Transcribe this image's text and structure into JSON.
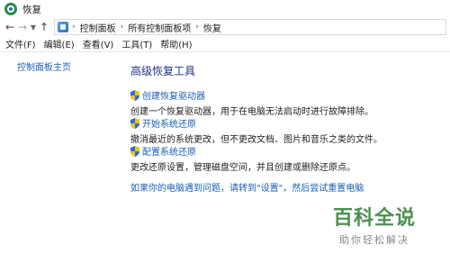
{
  "window": {
    "title": "恢复"
  },
  "address": {
    "crumbs": [
      "控制面板",
      "所有控制面板项",
      "恢复"
    ]
  },
  "menu": {
    "items": [
      "文件(F)",
      "编辑(E)",
      "查看(V)",
      "工具(T)",
      "帮助(H)"
    ]
  },
  "sidebar": {
    "home_link": "控制面板主页"
  },
  "main": {
    "heading": "高级恢复工具",
    "tasks": [
      {
        "link": "创建恢复驱动器",
        "description": "创建一个恢复驱动器，用于在电脑无法启动时进行故障排除。",
        "icon": "uac-shield-icon"
      },
      {
        "link": "开始系统还原",
        "description": "撤消最近的系统更改，但不更改文档、图片和音乐之类的文件。",
        "icon": "uac-shield-icon"
      },
      {
        "link": "配置系统还原",
        "description": "更改还原设置，管理磁盘空间，并且创建或删除还原点。",
        "icon": "uac-shield-icon"
      }
    ],
    "bottom_link": "如果你的电脑遇到问题，请转到\"设置\"，然后尝试重置电脑"
  },
  "watermark": {
    "logo": "百科全说",
    "sub": "助你轻松解决"
  }
}
